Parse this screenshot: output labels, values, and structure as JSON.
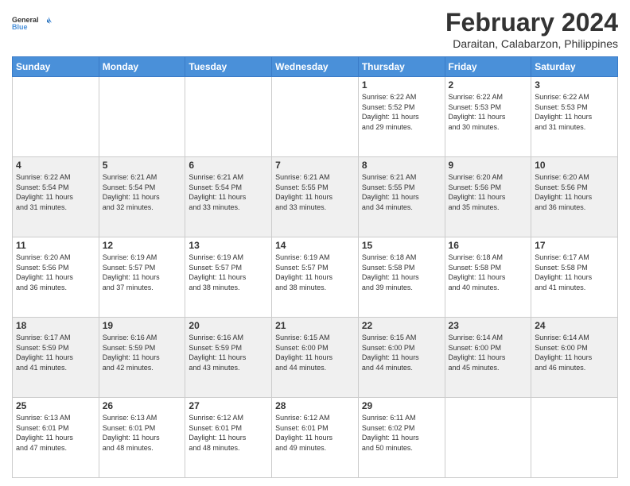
{
  "logo": {
    "line1": "General",
    "line2": "Blue"
  },
  "header": {
    "title": "February 2024",
    "location": "Daraitan, Calabarzon, Philippines"
  },
  "days_of_week": [
    "Sunday",
    "Monday",
    "Tuesday",
    "Wednesday",
    "Thursday",
    "Friday",
    "Saturday"
  ],
  "weeks": [
    [
      {
        "day": "",
        "content": ""
      },
      {
        "day": "",
        "content": ""
      },
      {
        "day": "",
        "content": ""
      },
      {
        "day": "",
        "content": ""
      },
      {
        "day": "1",
        "content": "Sunrise: 6:22 AM\nSunset: 5:52 PM\nDaylight: 11 hours\nand 29 minutes."
      },
      {
        "day": "2",
        "content": "Sunrise: 6:22 AM\nSunset: 5:53 PM\nDaylight: 11 hours\nand 30 minutes."
      },
      {
        "day": "3",
        "content": "Sunrise: 6:22 AM\nSunset: 5:53 PM\nDaylight: 11 hours\nand 31 minutes."
      }
    ],
    [
      {
        "day": "4",
        "content": "Sunrise: 6:22 AM\nSunset: 5:54 PM\nDaylight: 11 hours\nand 31 minutes."
      },
      {
        "day": "5",
        "content": "Sunrise: 6:21 AM\nSunset: 5:54 PM\nDaylight: 11 hours\nand 32 minutes."
      },
      {
        "day": "6",
        "content": "Sunrise: 6:21 AM\nSunset: 5:54 PM\nDaylight: 11 hours\nand 33 minutes."
      },
      {
        "day": "7",
        "content": "Sunrise: 6:21 AM\nSunset: 5:55 PM\nDaylight: 11 hours\nand 33 minutes."
      },
      {
        "day": "8",
        "content": "Sunrise: 6:21 AM\nSunset: 5:55 PM\nDaylight: 11 hours\nand 34 minutes."
      },
      {
        "day": "9",
        "content": "Sunrise: 6:20 AM\nSunset: 5:56 PM\nDaylight: 11 hours\nand 35 minutes."
      },
      {
        "day": "10",
        "content": "Sunrise: 6:20 AM\nSunset: 5:56 PM\nDaylight: 11 hours\nand 36 minutes."
      }
    ],
    [
      {
        "day": "11",
        "content": "Sunrise: 6:20 AM\nSunset: 5:56 PM\nDaylight: 11 hours\nand 36 minutes."
      },
      {
        "day": "12",
        "content": "Sunrise: 6:19 AM\nSunset: 5:57 PM\nDaylight: 11 hours\nand 37 minutes."
      },
      {
        "day": "13",
        "content": "Sunrise: 6:19 AM\nSunset: 5:57 PM\nDaylight: 11 hours\nand 38 minutes."
      },
      {
        "day": "14",
        "content": "Sunrise: 6:19 AM\nSunset: 5:57 PM\nDaylight: 11 hours\nand 38 minutes."
      },
      {
        "day": "15",
        "content": "Sunrise: 6:18 AM\nSunset: 5:58 PM\nDaylight: 11 hours\nand 39 minutes."
      },
      {
        "day": "16",
        "content": "Sunrise: 6:18 AM\nSunset: 5:58 PM\nDaylight: 11 hours\nand 40 minutes."
      },
      {
        "day": "17",
        "content": "Sunrise: 6:17 AM\nSunset: 5:58 PM\nDaylight: 11 hours\nand 41 minutes."
      }
    ],
    [
      {
        "day": "18",
        "content": "Sunrise: 6:17 AM\nSunset: 5:59 PM\nDaylight: 11 hours\nand 41 minutes."
      },
      {
        "day": "19",
        "content": "Sunrise: 6:16 AM\nSunset: 5:59 PM\nDaylight: 11 hours\nand 42 minutes."
      },
      {
        "day": "20",
        "content": "Sunrise: 6:16 AM\nSunset: 5:59 PM\nDaylight: 11 hours\nand 43 minutes."
      },
      {
        "day": "21",
        "content": "Sunrise: 6:15 AM\nSunset: 6:00 PM\nDaylight: 11 hours\nand 44 minutes."
      },
      {
        "day": "22",
        "content": "Sunrise: 6:15 AM\nSunset: 6:00 PM\nDaylight: 11 hours\nand 44 minutes."
      },
      {
        "day": "23",
        "content": "Sunrise: 6:14 AM\nSunset: 6:00 PM\nDaylight: 11 hours\nand 45 minutes."
      },
      {
        "day": "24",
        "content": "Sunrise: 6:14 AM\nSunset: 6:00 PM\nDaylight: 11 hours\nand 46 minutes."
      }
    ],
    [
      {
        "day": "25",
        "content": "Sunrise: 6:13 AM\nSunset: 6:01 PM\nDaylight: 11 hours\nand 47 minutes."
      },
      {
        "day": "26",
        "content": "Sunrise: 6:13 AM\nSunset: 6:01 PM\nDaylight: 11 hours\nand 48 minutes."
      },
      {
        "day": "27",
        "content": "Sunrise: 6:12 AM\nSunset: 6:01 PM\nDaylight: 11 hours\nand 48 minutes."
      },
      {
        "day": "28",
        "content": "Sunrise: 6:12 AM\nSunset: 6:01 PM\nDaylight: 11 hours\nand 49 minutes."
      },
      {
        "day": "29",
        "content": "Sunrise: 6:11 AM\nSunset: 6:02 PM\nDaylight: 11 hours\nand 50 minutes."
      },
      {
        "day": "",
        "content": ""
      },
      {
        "day": "",
        "content": ""
      }
    ]
  ]
}
